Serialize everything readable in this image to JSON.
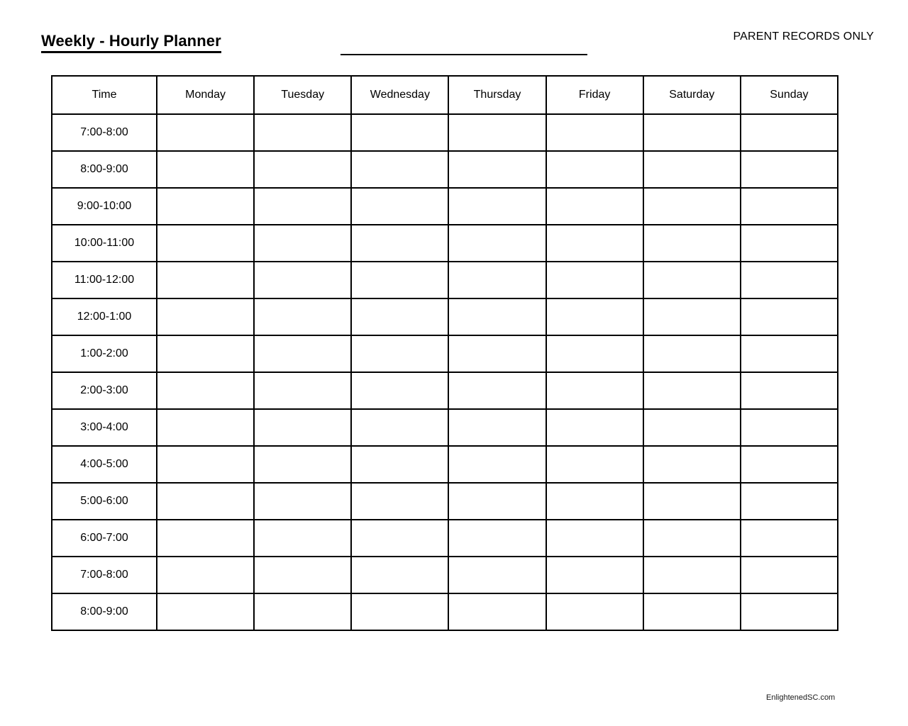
{
  "header": {
    "title": "Weekly - Hourly Planner",
    "blank_line_value": "",
    "blank_line_placeholder": "",
    "note": "PARENT RECORDS ONLY"
  },
  "table": {
    "columns": [
      "Time",
      "Monday",
      "Tuesday",
      "Wednesday",
      "Thursday",
      "Friday",
      "Saturday",
      "Sunday"
    ],
    "time_slots": [
      "7:00-8:00",
      "8:00-9:00",
      "9:00-10:00",
      "10:00-11:00",
      "11:00-12:00",
      "12:00-1:00",
      "1:00-2:00",
      "2:00-3:00",
      "3:00-4:00",
      "4:00-5:00",
      "5:00-6:00",
      "6:00-7:00",
      "7:00-8:00",
      "8:00-9:00"
    ],
    "cells": [
      [
        "",
        "",
        "",
        "",
        "",
        "",
        ""
      ],
      [
        "",
        "",
        "",
        "",
        "",
        "",
        ""
      ],
      [
        "",
        "",
        "",
        "",
        "",
        "",
        ""
      ],
      [
        "",
        "",
        "",
        "",
        "",
        "",
        ""
      ],
      [
        "",
        "",
        "",
        "",
        "",
        "",
        ""
      ],
      [
        "",
        "",
        "",
        "",
        "",
        "",
        ""
      ],
      [
        "",
        "",
        "",
        "",
        "",
        "",
        ""
      ],
      [
        "",
        "",
        "",
        "",
        "",
        "",
        ""
      ],
      [
        "",
        "",
        "",
        "",
        "",
        "",
        ""
      ],
      [
        "",
        "",
        "",
        "",
        "",
        "",
        ""
      ],
      [
        "",
        "",
        "",
        "",
        "",
        "",
        ""
      ],
      [
        "",
        "",
        "",
        "",
        "",
        "",
        ""
      ],
      [
        "",
        "",
        "",
        "",
        "",
        "",
        ""
      ],
      [
        "",
        "",
        "",
        "",
        "",
        "",
        ""
      ]
    ]
  },
  "footer": {
    "credit": "EnlightenedSC.com"
  },
  "colors": {
    "ink": "#000000",
    "paper": "#ffffff"
  }
}
